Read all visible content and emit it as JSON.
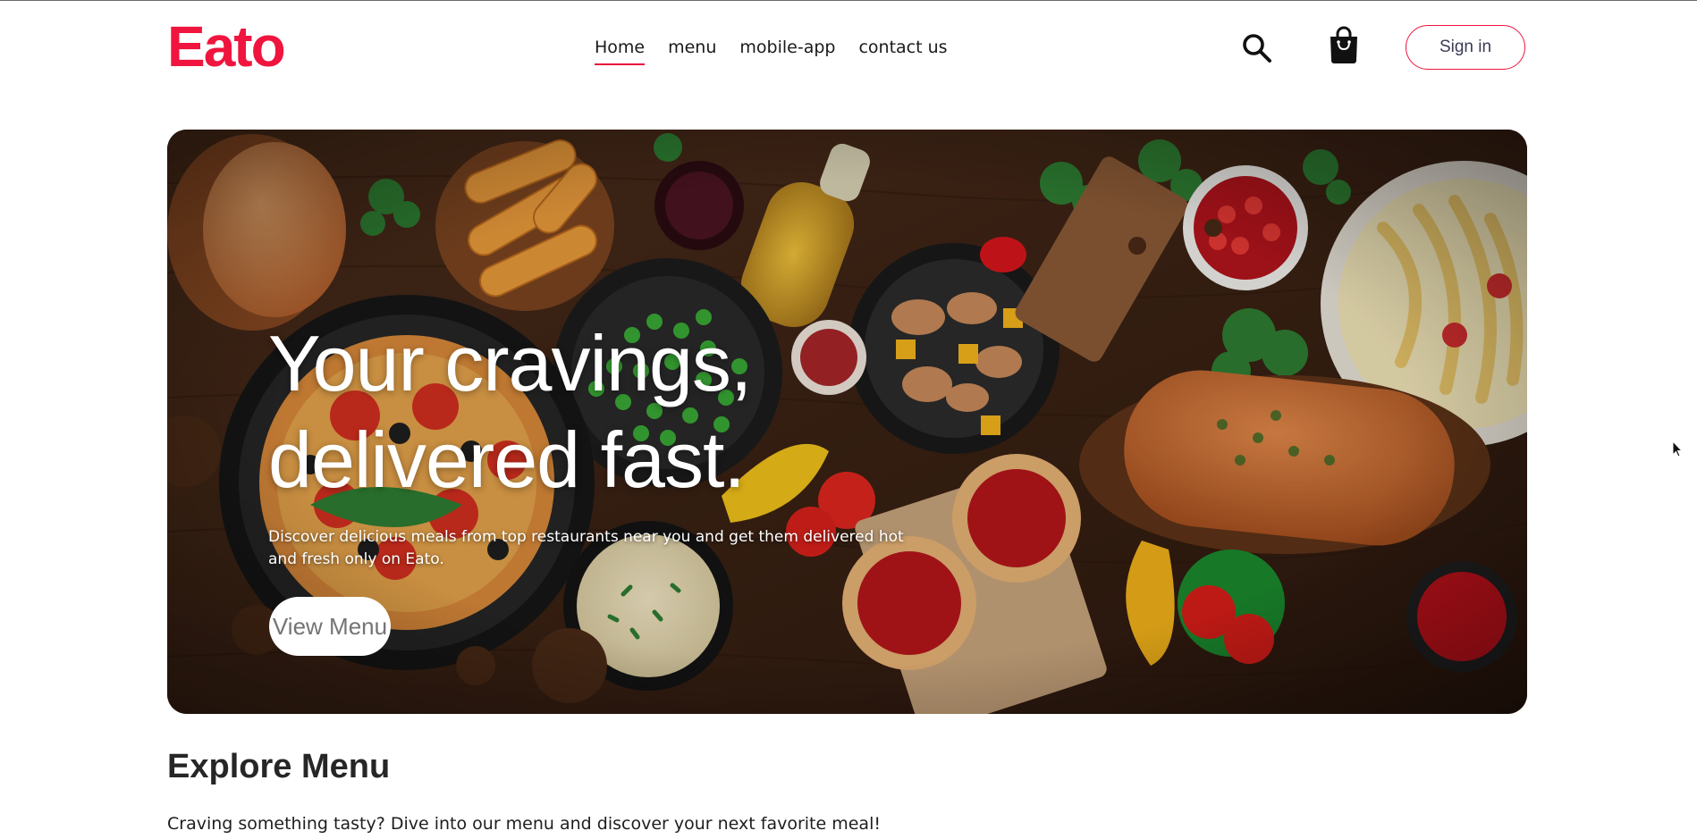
{
  "brand": {
    "logo_text": "Eato",
    "accent_color": "#f0153e"
  },
  "nav": {
    "links": [
      {
        "label": "Home",
        "active": true
      },
      {
        "label": "menu",
        "active": false
      },
      {
        "label": "mobile-app",
        "active": false
      },
      {
        "label": "contact us",
        "active": false
      }
    ],
    "search_icon": "search-icon",
    "basket_icon": "shopping-bag-icon",
    "signin_label": "Sign in"
  },
  "hero": {
    "title_line1": "Your cravings,",
    "title_line2": "delivered fast.",
    "subtitle": "Discover delicious meals from top restaurants near you and get them delivered hot and fresh only on Eato.",
    "button_label": "View Menu"
  },
  "explore": {
    "title": "Explore Menu",
    "description": "Craving something tasty? Dive into our menu and discover your next favorite meal!"
  }
}
